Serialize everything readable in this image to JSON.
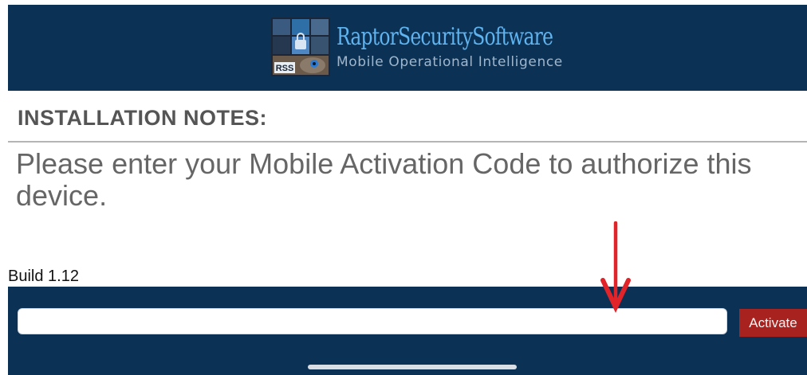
{
  "header": {
    "brand_name": "RaptorSecuritySoftware",
    "tagline": "Mobile Operational Intelligence",
    "logo_badge": "RSS",
    "background_color": "#0b3155"
  },
  "notes": {
    "title": "INSTALLATION NOTES:",
    "body": "Please enter your Mobile Activation Code to authorize this device."
  },
  "build": {
    "label": "Build 1.12"
  },
  "activation": {
    "code_value": "",
    "placeholder": "",
    "button_label": "Activate",
    "button_color": "#a8231f"
  },
  "annotation": {
    "arrow_color": "#e0242a",
    "icon": "down-arrow-icon"
  }
}
